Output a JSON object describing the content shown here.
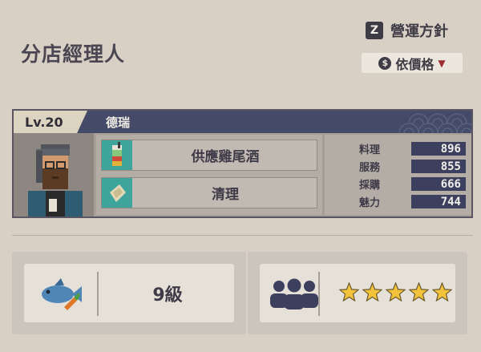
{
  "header": {
    "title": "分店經理人",
    "policy_key": "Z",
    "policy_label": "營運方針",
    "sort_icon": "coin-icon",
    "sort_label": "依價格"
  },
  "manager": {
    "level": "Lv.20",
    "name": "德瑞",
    "jobs": [
      {
        "label": "供應雞尾酒",
        "icon": "cocktail-icon"
      },
      {
        "label": "清理",
        "icon": "cleaning-cloth-icon"
      }
    ],
    "stats": [
      {
        "label": "料理",
        "value": "896"
      },
      {
        "label": "服務",
        "value": "855"
      },
      {
        "label": "採購",
        "value": "666"
      },
      {
        "label": "魅力",
        "value": "744"
      }
    ]
  },
  "ingredient_panel": {
    "icon": "fish-and-carrot-icon",
    "level_text": "9級"
  },
  "crew_panel": {
    "icon": "staff-group-icon",
    "rating": 5,
    "max_rating": 5
  },
  "colors": {
    "background": "#d8d0c5",
    "header_band": "#454a69",
    "stat_box": "#3c3f5e",
    "job_icon": "#3fa59c",
    "star": "#f2c33a"
  }
}
